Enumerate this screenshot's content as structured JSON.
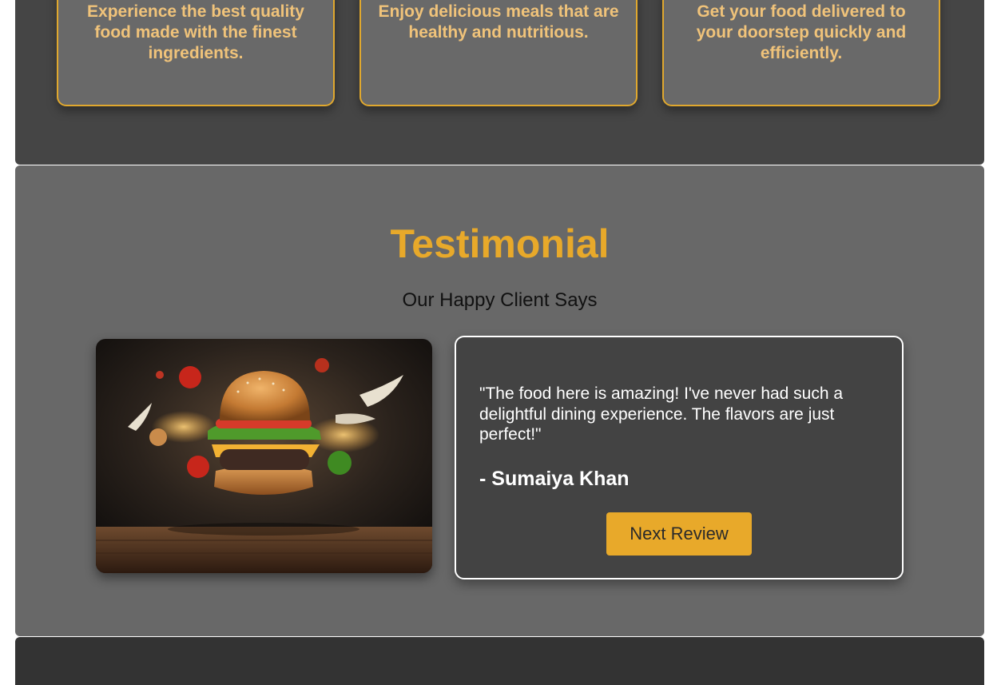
{
  "features": [
    {
      "text": "Experience the best quality food made with the finest ingredients."
    },
    {
      "text": "Enjoy delicious meals that are healthy and nutritious."
    },
    {
      "text": "Get your food delivered to your doorstep quickly and efficiently."
    }
  ],
  "testimonial": {
    "title": "Testimonial",
    "subtitle": "Our Happy Client Says",
    "image_alt": "burger-photo",
    "review": {
      "quote": "\"The food here is amazing! I've never had such a delightful dining experience. The flavors are just perfect!\"",
      "author": "- Sumaiya Khan"
    },
    "next_button_label": "Next Review"
  },
  "colors": {
    "accent": "#e8a92a",
    "card_text": "#f0c37a",
    "section_dark": "#454545",
    "section_mid": "#686868",
    "footer": "#333333"
  }
}
